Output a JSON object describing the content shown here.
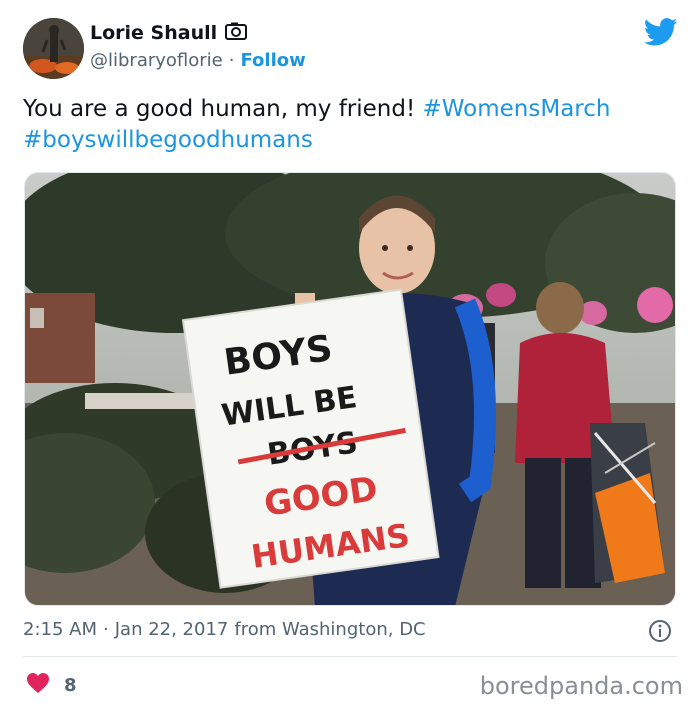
{
  "author": {
    "name": "Lorie Shaull",
    "handle": "@libraryoflorie",
    "separator": "·",
    "follow_label": "Follow",
    "verified_icon": "camera-icon"
  },
  "tweet": {
    "text_main": "You are a good human, my friend! ",
    "hashtags": [
      "#WomensMarch",
      "#boyswillbegoodhumans"
    ]
  },
  "photo": {
    "sign_lines": [
      "BOYS",
      "WILL BE",
      "BOYS",
      "GOOD",
      "HUMANS"
    ]
  },
  "meta": {
    "time": "2:15 AM",
    "separator": "·",
    "date": "Jan 22, 2017",
    "source": "from Washington, DC"
  },
  "engagement": {
    "likes": "8"
  },
  "watermark": "boredpanda.com",
  "colors": {
    "accent": "#1b95e0",
    "heart": "#e0245e",
    "secondary_text": "#536471"
  }
}
